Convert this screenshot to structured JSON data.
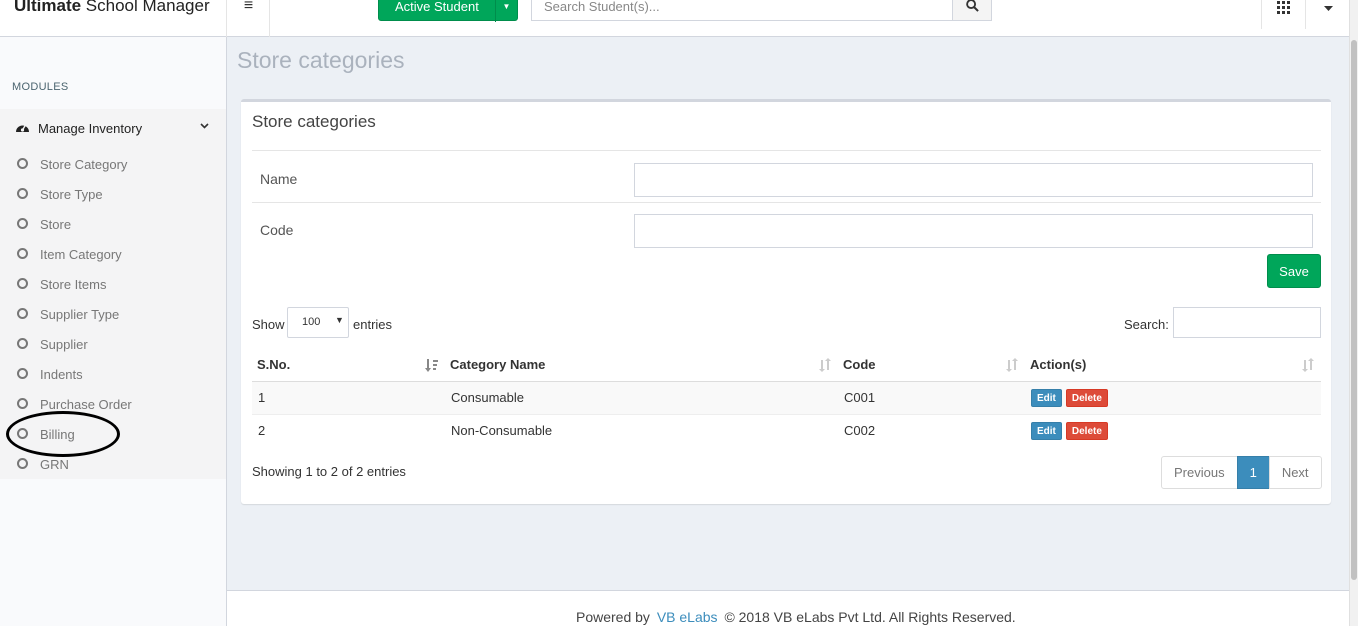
{
  "brand": {
    "bold": "Ultimate",
    "rest": " School Manager"
  },
  "topbar": {
    "active_student_label": "Active Student",
    "search_placeholder": "Search Student(s)..."
  },
  "sidebar": {
    "header": "MODULES",
    "parent_label": "Manage Inventory",
    "items": [
      {
        "label": "Store Category"
      },
      {
        "label": "Store Type"
      },
      {
        "label": "Store"
      },
      {
        "label": "Item Category"
      },
      {
        "label": "Store Items"
      },
      {
        "label": "Supplier Type"
      },
      {
        "label": "Supplier"
      },
      {
        "label": "Indents"
      },
      {
        "label": "Purchase Order"
      },
      {
        "label": "Billing"
      },
      {
        "label": "GRN"
      }
    ]
  },
  "page": {
    "title": "Store categories",
    "box_title": "Store categories"
  },
  "form": {
    "name_label": "Name",
    "name_value": "",
    "code_label": "Code",
    "code_value": "",
    "save_label": "Save"
  },
  "datatable": {
    "show_label": "Show",
    "length_value": "100",
    "entries_label": "entries",
    "search_label": "Search:",
    "search_value": "",
    "columns": [
      "S.No.",
      "Category Name",
      "Code",
      "Action(s)"
    ],
    "rows": [
      {
        "sno": "1",
        "name": "Consumable",
        "code": "C001"
      },
      {
        "sno": "2",
        "name": "Non-Consumable",
        "code": "C002"
      }
    ],
    "edit_label": "Edit",
    "delete_label": "Delete",
    "info": "Showing 1 to 2 of 2 entries",
    "pagination": {
      "previous": "Previous",
      "current": "1",
      "next": "Next"
    }
  },
  "footer": {
    "powered_by": "Powered by",
    "company_link": "VB eLabs",
    "copyright": "© 2018 VB eLabs Pvt Ltd. All Rights Reserved."
  },
  "colors": {
    "green": "#00a65a",
    "blue": "#3c8dbc",
    "red": "#dd4b39"
  }
}
